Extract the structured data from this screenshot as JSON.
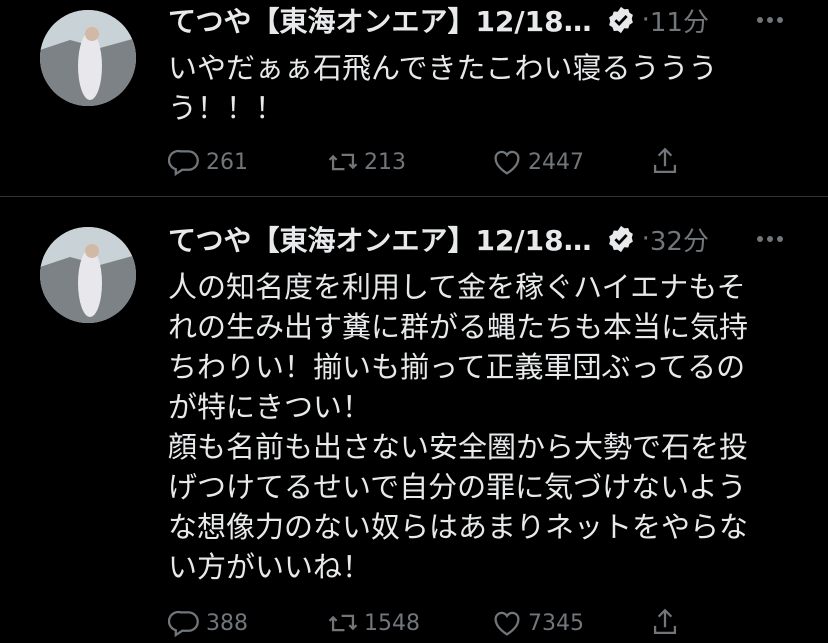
{
  "tweets": [
    {
      "author": "てつや【東海オンエア】12/18…",
      "separator": "·",
      "time": "11分",
      "text": "いやだぁぁ石飛んできたこわい寝るうううう！！！",
      "replies": "261",
      "retweets": "213",
      "likes": "2447"
    },
    {
      "author": "てつや【東海オンエア】12/18…",
      "separator": "·",
      "time": "32分",
      "text": "人の知名度を利用して金を稼ぐハイエナもそれの生み出す糞に群がる蝿たちも本当に気持ちわりい！揃いも揃って正義軍団ぶってるのが特にきつい！\n顔も名前も出さない安全圏から大勢で石を投げつけてるせいで自分の罪に気づけないような想像力のない奴らはあまりネットをやらない方がいいね！",
      "replies": "388",
      "retweets": "1548",
      "likes": "7345"
    }
  ],
  "colors": {
    "background": "#000000",
    "text": "#e7e9ea",
    "muted": "#71767b",
    "divider": "#2f3336"
  },
  "icons": [
    "avatar",
    "verified-badge-icon",
    "more-icon",
    "reply-icon",
    "retweet-icon",
    "like-icon",
    "share-icon"
  ]
}
